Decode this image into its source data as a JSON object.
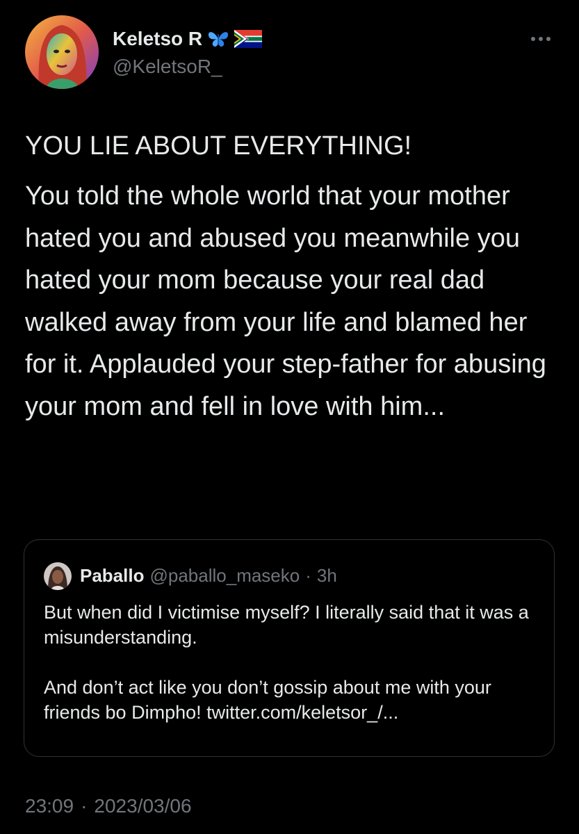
{
  "author": {
    "display_name": "Keletso R",
    "handle": "@KeletsoR_",
    "badges": [
      "butterfly-icon",
      "south-africa-flag-icon"
    ]
  },
  "tweet": {
    "headline": "YOU LIE ABOUT EVERYTHING!",
    "body": "You told the whole world that your mother hated you and abused you meanwhile you hated your mom because your real dad walked away from your life and blamed her for it. Applauded your step-father for abusing your mom and fell in love with him..."
  },
  "quote": {
    "display_name": "Paballo",
    "handle": "@paballo_maseko",
    "separator": "·",
    "time": "3h",
    "paragraph1": "But when did I victimise myself? I literally said that it was a misunderstanding.",
    "paragraph2": "And don’t act like you don’t gossip about me with your friends bo Dimpho! twitter.com/keletsor_/..."
  },
  "footer": {
    "time": "23:09",
    "separator": "·",
    "date": "2023/03/06"
  },
  "colors": {
    "background": "#000000",
    "text_primary": "#e7e9ea",
    "text_secondary": "#71767b",
    "border": "#2f3336"
  }
}
